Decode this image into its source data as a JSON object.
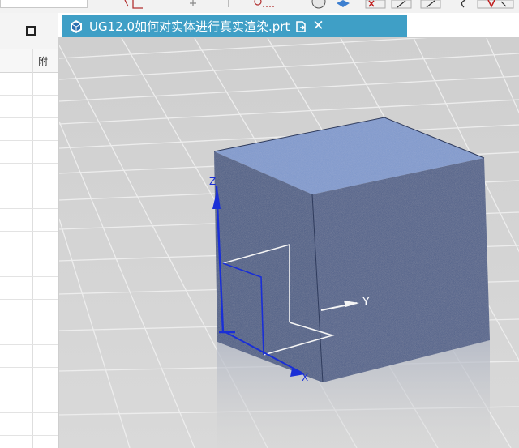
{
  "window": {
    "tab_title": "UG12.0如何对实体进行真实渲染.prt",
    "tab_close_glyph": "✕",
    "tab_icon": "part-file-icon",
    "pin_icon": "pin-document-icon"
  },
  "navigator": {
    "column_header": "附"
  },
  "viewport": {
    "axes": {
      "x": "X",
      "y": "Y",
      "z": "Z"
    }
  },
  "colors": {
    "tab_active": "#3f9fc6",
    "cube_front": "#4a5b86",
    "cube_top": "#7f9ad0",
    "axis_blue": "#1a2fd6",
    "grid_background": "#d2d2d2"
  }
}
